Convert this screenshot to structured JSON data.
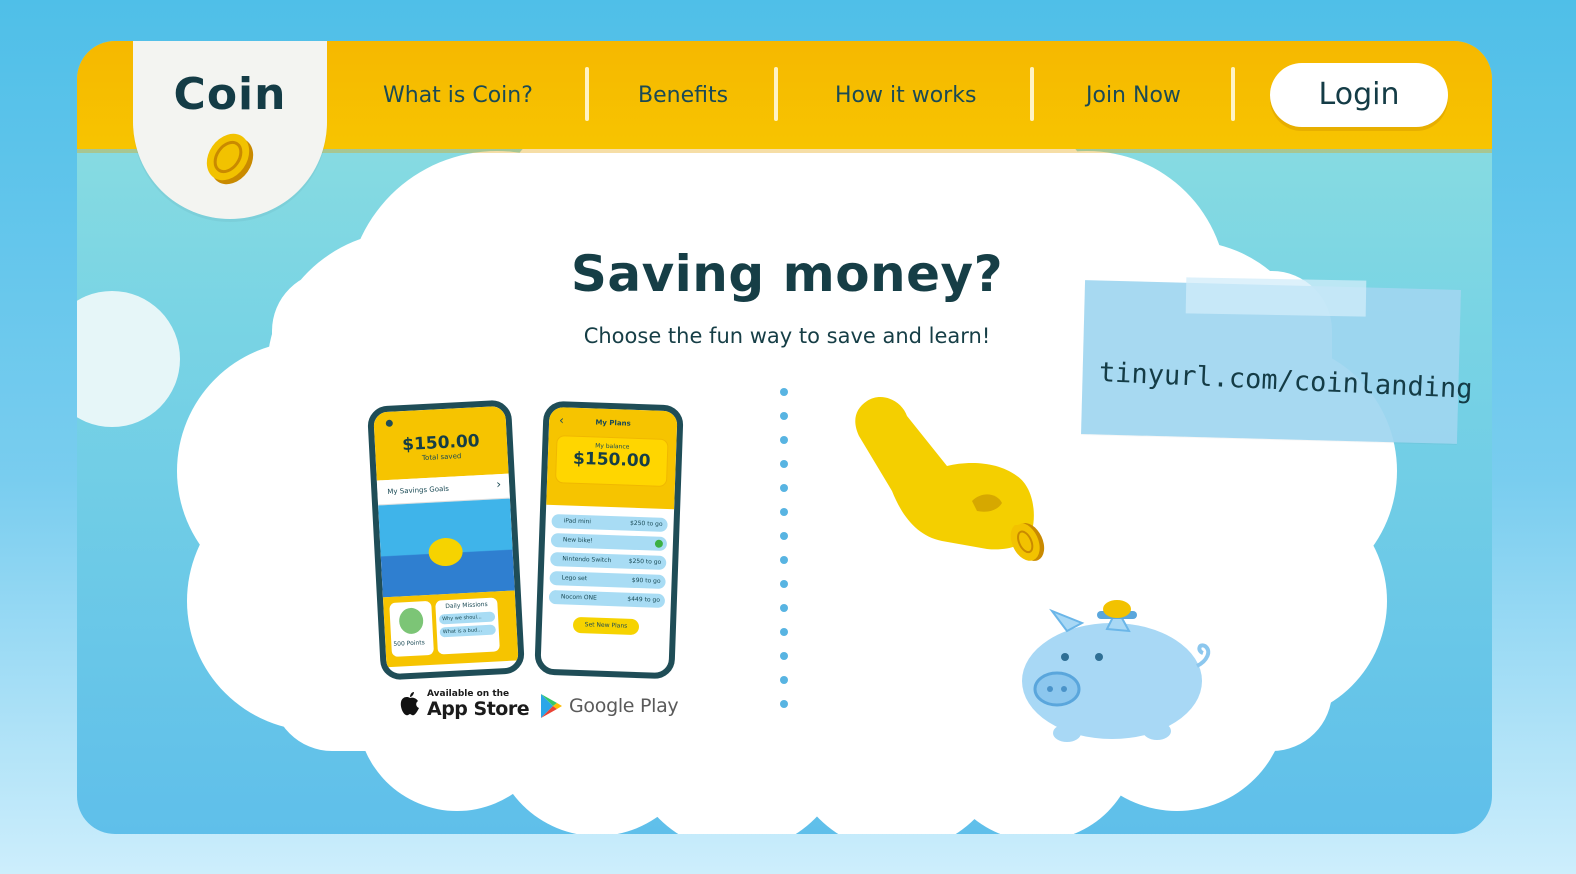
{
  "brand": {
    "name": "Coin"
  },
  "nav": {
    "items": [
      {
        "label": "What is Coin?"
      },
      {
        "label": "Benefits"
      },
      {
        "label": "How it works"
      },
      {
        "label": "Join Now"
      }
    ],
    "login_label": "Login"
  },
  "hero": {
    "title": "Saving money?",
    "subtitle": "Choose the fun way to save and learn!"
  },
  "phone1": {
    "balance": "$150.00",
    "balance_caption": "Total saved",
    "goals_label": "My Savings Goals",
    "points": "500 Points",
    "missions_title": "Daily Missions",
    "missions": [
      "Why we shoul...",
      "What is a bud..."
    ]
  },
  "phone2": {
    "title": "My Plans",
    "balance_caption": "My balance",
    "balance": "$150.00",
    "plans": [
      {
        "name": "iPad mini",
        "note": "$250 to go"
      },
      {
        "name": "New bike!",
        "note": ""
      },
      {
        "name": "Nintendo Switch",
        "note": "$250 to go"
      },
      {
        "name": "Lego set",
        "note": "$90 to go"
      },
      {
        "name": "Nocom ONE",
        "note": "$449 to go"
      }
    ],
    "button": "Set New Plans"
  },
  "stores": {
    "apple_small": "Available on the",
    "apple_big": "App Store",
    "google": "Google Play"
  },
  "note": {
    "url": "tinyurl.com/coinlanding"
  },
  "colors": {
    "header": "#f6b800",
    "accent_text": "#143c46",
    "sky": "#79d4e4",
    "cloud": "#ffffff",
    "piggy": "#a8d8f5",
    "hand": "#f4cf00"
  }
}
